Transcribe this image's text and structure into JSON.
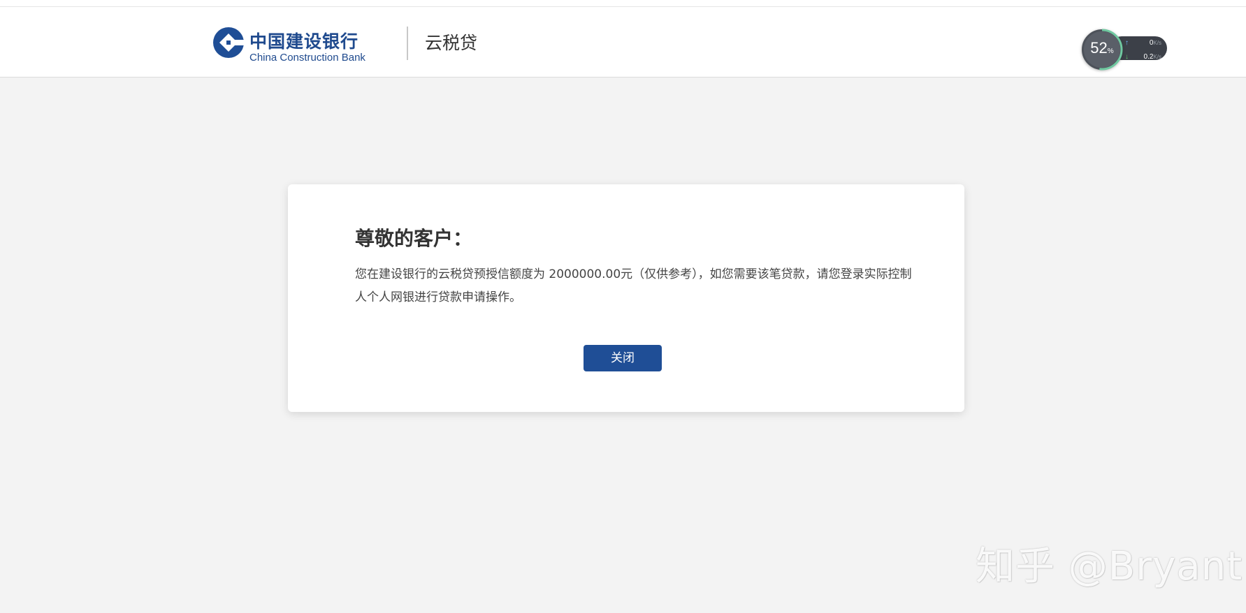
{
  "header": {
    "bank_name_cn": "中国建设银行",
    "bank_name_en": "China Construction Bank",
    "product_name": "云税贷"
  },
  "network_monitor": {
    "percent": "52",
    "percent_unit": "%",
    "upload_value": "0",
    "download_value": "0.2",
    "rate_unit": "K/s"
  },
  "dialog": {
    "greeting": "尊敬的客户：",
    "message": "您在建设银行的云税贷预授信额度为 2000000.00元（仅供参考），如您需要该笔贷款，请您登录实际控制人个人网银进行贷款申请操作。",
    "close_label": "关闭"
  },
  "watermark": {
    "text": "知乎 @Bryant"
  },
  "colors": {
    "brand_blue": "#1f4e96",
    "background": "#f3f3f3",
    "card": "#ffffff"
  },
  "icons": {
    "logo": "ccb-logo-icon",
    "upload": "arrow-up-icon",
    "download": "arrow-down-icon"
  }
}
